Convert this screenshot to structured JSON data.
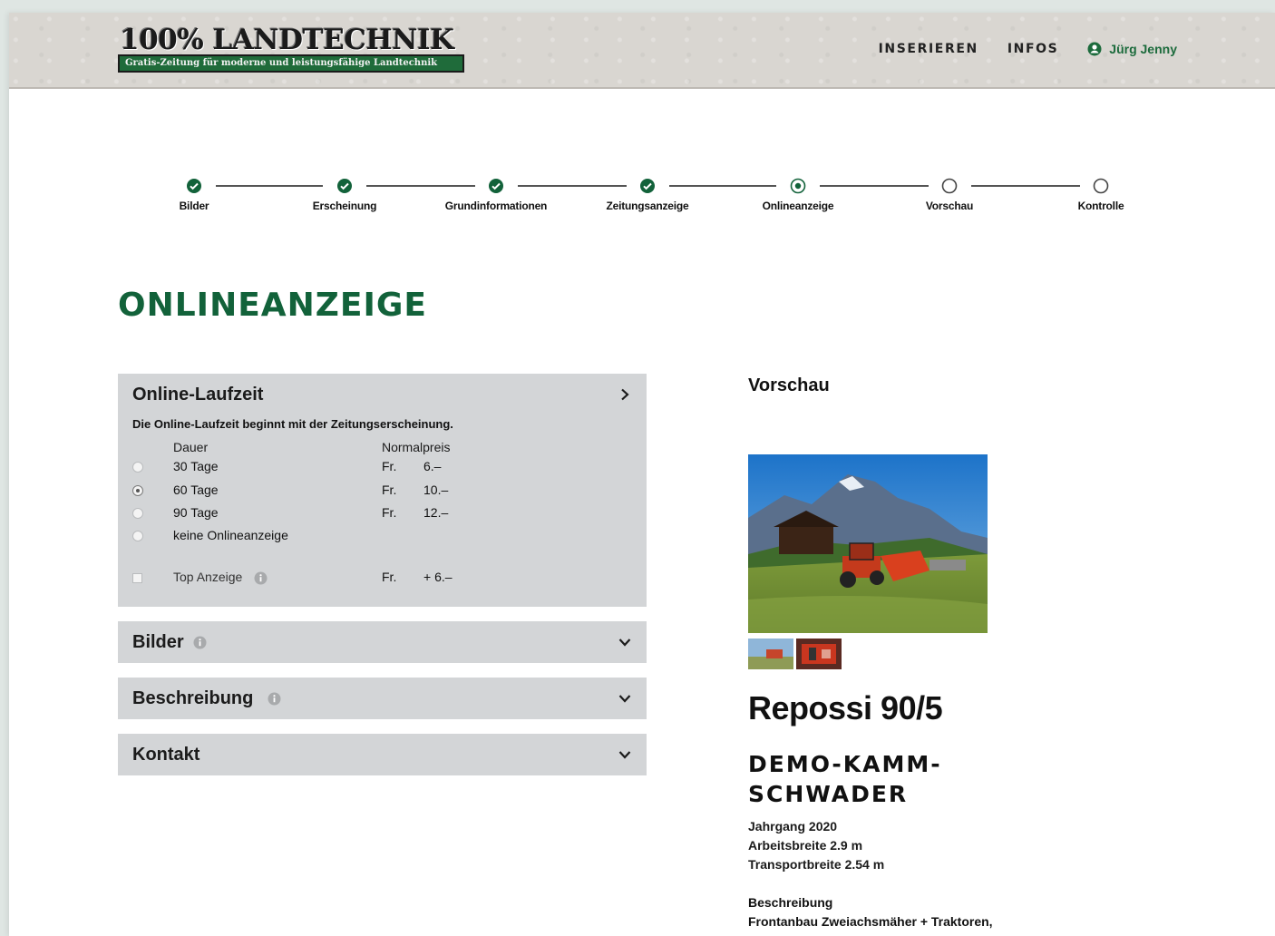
{
  "header": {
    "logo_title": "100% LANDTECHNIK",
    "logo_tagline": "Gratis-Zeitung für moderne und leistungsfähige Landtechnik",
    "nav": [
      "INSERIEREN",
      "INFOS"
    ],
    "user_name": "Jürg Jenny"
  },
  "stepper": {
    "steps": [
      {
        "label": "Bilder",
        "state": "done"
      },
      {
        "label": "Erscheinung",
        "state": "done"
      },
      {
        "label": "Grundinformationen",
        "state": "done"
      },
      {
        "label": "Zeitungsanzeige",
        "state": "done"
      },
      {
        "label": "Onlineanzeige",
        "state": "current"
      },
      {
        "label": "Vorschau",
        "state": "todo"
      },
      {
        "label": "Kontrolle",
        "state": "todo"
      }
    ]
  },
  "page_title": "ONLINEANZEIGE",
  "laufzeit": {
    "title": "Online-Laufzeit",
    "subtitle": "Die Online-Laufzeit beginnt mit der Zeitungserscheinung.",
    "col_duration": "Dauer",
    "col_price": "Normalpreis",
    "options": [
      {
        "label": "30 Tage",
        "currency": "Fr.",
        "amount": "6.–",
        "selected": false
      },
      {
        "label": "60 Tage",
        "currency": "Fr.",
        "amount": "10.–",
        "selected": true
      },
      {
        "label": "90 Tage",
        "currency": "Fr.",
        "amount": "12.–",
        "selected": false
      },
      {
        "label": "keine Onlineanzeige",
        "currency": "",
        "amount": "",
        "selected": false
      }
    ],
    "top": {
      "label": "Top Anzeige",
      "currency": "Fr.",
      "amount": "+ 6.–",
      "checked": false
    }
  },
  "sections": {
    "bilder": "Bilder",
    "beschreibung": "Beschreibung",
    "kontakt": "Kontakt"
  },
  "preview": {
    "label": "Vorschau",
    "title": "Repossi 90/5",
    "subtitle": "DEMO-KAMM-SCHWADER",
    "specs": [
      "Jahrgang 2020",
      "Arbeitsbreite 2.9 m",
      "Transportbreite 2.54 m"
    ],
    "desc_heading": "Beschreibung",
    "desc_line": "Frontanbau Zweiachsmäher + Traktoren,"
  },
  "colors": {
    "brand_green": "#12623a",
    "panel_gray": "#d3d5d7"
  }
}
